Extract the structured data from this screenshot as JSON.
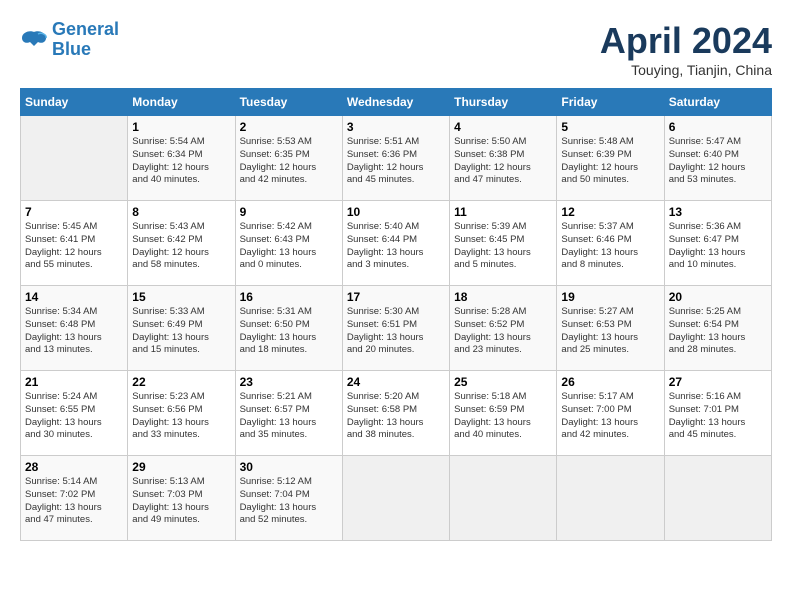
{
  "header": {
    "logo_line1": "General",
    "logo_line2": "Blue",
    "month_title": "April 2024",
    "location": "Touying, Tianjin, China"
  },
  "weekdays": [
    "Sunday",
    "Monday",
    "Tuesday",
    "Wednesday",
    "Thursday",
    "Friday",
    "Saturday"
  ],
  "weeks": [
    [
      {
        "day": "",
        "info": ""
      },
      {
        "day": "1",
        "info": "Sunrise: 5:54 AM\nSunset: 6:34 PM\nDaylight: 12 hours\nand 40 minutes."
      },
      {
        "day": "2",
        "info": "Sunrise: 5:53 AM\nSunset: 6:35 PM\nDaylight: 12 hours\nand 42 minutes."
      },
      {
        "day": "3",
        "info": "Sunrise: 5:51 AM\nSunset: 6:36 PM\nDaylight: 12 hours\nand 45 minutes."
      },
      {
        "day": "4",
        "info": "Sunrise: 5:50 AM\nSunset: 6:38 PM\nDaylight: 12 hours\nand 47 minutes."
      },
      {
        "day": "5",
        "info": "Sunrise: 5:48 AM\nSunset: 6:39 PM\nDaylight: 12 hours\nand 50 minutes."
      },
      {
        "day": "6",
        "info": "Sunrise: 5:47 AM\nSunset: 6:40 PM\nDaylight: 12 hours\nand 53 minutes."
      }
    ],
    [
      {
        "day": "7",
        "info": "Sunrise: 5:45 AM\nSunset: 6:41 PM\nDaylight: 12 hours\nand 55 minutes."
      },
      {
        "day": "8",
        "info": "Sunrise: 5:43 AM\nSunset: 6:42 PM\nDaylight: 12 hours\nand 58 minutes."
      },
      {
        "day": "9",
        "info": "Sunrise: 5:42 AM\nSunset: 6:43 PM\nDaylight: 13 hours\nand 0 minutes."
      },
      {
        "day": "10",
        "info": "Sunrise: 5:40 AM\nSunset: 6:44 PM\nDaylight: 13 hours\nand 3 minutes."
      },
      {
        "day": "11",
        "info": "Sunrise: 5:39 AM\nSunset: 6:45 PM\nDaylight: 13 hours\nand 5 minutes."
      },
      {
        "day": "12",
        "info": "Sunrise: 5:37 AM\nSunset: 6:46 PM\nDaylight: 13 hours\nand 8 minutes."
      },
      {
        "day": "13",
        "info": "Sunrise: 5:36 AM\nSunset: 6:47 PM\nDaylight: 13 hours\nand 10 minutes."
      }
    ],
    [
      {
        "day": "14",
        "info": "Sunrise: 5:34 AM\nSunset: 6:48 PM\nDaylight: 13 hours\nand 13 minutes."
      },
      {
        "day": "15",
        "info": "Sunrise: 5:33 AM\nSunset: 6:49 PM\nDaylight: 13 hours\nand 15 minutes."
      },
      {
        "day": "16",
        "info": "Sunrise: 5:31 AM\nSunset: 6:50 PM\nDaylight: 13 hours\nand 18 minutes."
      },
      {
        "day": "17",
        "info": "Sunrise: 5:30 AM\nSunset: 6:51 PM\nDaylight: 13 hours\nand 20 minutes."
      },
      {
        "day": "18",
        "info": "Sunrise: 5:28 AM\nSunset: 6:52 PM\nDaylight: 13 hours\nand 23 minutes."
      },
      {
        "day": "19",
        "info": "Sunrise: 5:27 AM\nSunset: 6:53 PM\nDaylight: 13 hours\nand 25 minutes."
      },
      {
        "day": "20",
        "info": "Sunrise: 5:25 AM\nSunset: 6:54 PM\nDaylight: 13 hours\nand 28 minutes."
      }
    ],
    [
      {
        "day": "21",
        "info": "Sunrise: 5:24 AM\nSunset: 6:55 PM\nDaylight: 13 hours\nand 30 minutes."
      },
      {
        "day": "22",
        "info": "Sunrise: 5:23 AM\nSunset: 6:56 PM\nDaylight: 13 hours\nand 33 minutes."
      },
      {
        "day": "23",
        "info": "Sunrise: 5:21 AM\nSunset: 6:57 PM\nDaylight: 13 hours\nand 35 minutes."
      },
      {
        "day": "24",
        "info": "Sunrise: 5:20 AM\nSunset: 6:58 PM\nDaylight: 13 hours\nand 38 minutes."
      },
      {
        "day": "25",
        "info": "Sunrise: 5:18 AM\nSunset: 6:59 PM\nDaylight: 13 hours\nand 40 minutes."
      },
      {
        "day": "26",
        "info": "Sunrise: 5:17 AM\nSunset: 7:00 PM\nDaylight: 13 hours\nand 42 minutes."
      },
      {
        "day": "27",
        "info": "Sunrise: 5:16 AM\nSunset: 7:01 PM\nDaylight: 13 hours\nand 45 minutes."
      }
    ],
    [
      {
        "day": "28",
        "info": "Sunrise: 5:14 AM\nSunset: 7:02 PM\nDaylight: 13 hours\nand 47 minutes."
      },
      {
        "day": "29",
        "info": "Sunrise: 5:13 AM\nSunset: 7:03 PM\nDaylight: 13 hours\nand 49 minutes."
      },
      {
        "day": "30",
        "info": "Sunrise: 5:12 AM\nSunset: 7:04 PM\nDaylight: 13 hours\nand 52 minutes."
      },
      {
        "day": "",
        "info": ""
      },
      {
        "day": "",
        "info": ""
      },
      {
        "day": "",
        "info": ""
      },
      {
        "day": "",
        "info": ""
      }
    ]
  ]
}
